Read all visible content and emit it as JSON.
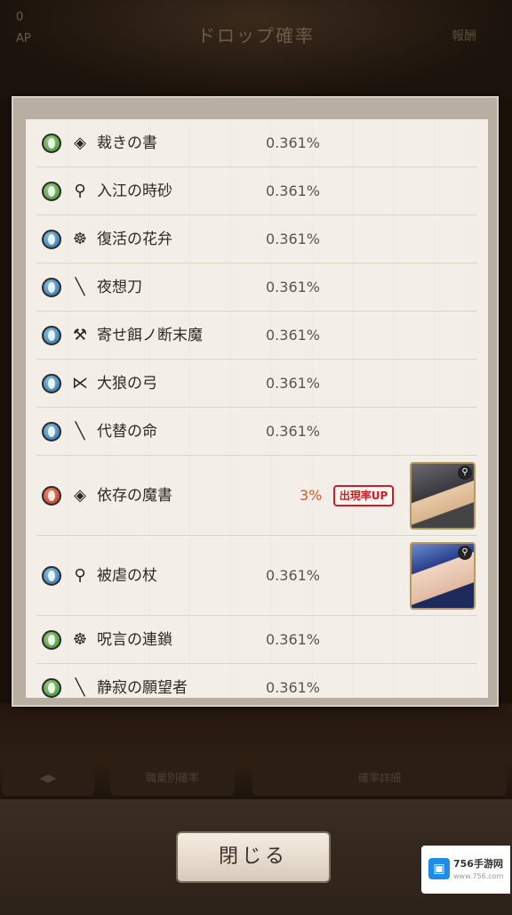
{
  "background": {
    "title": "ドロップ確率",
    "top_left_lines": [
      "0",
      "AP"
    ],
    "top_right": "報酬",
    "tabs": [
      "",
      "職業別確率",
      "確率詳細"
    ]
  },
  "items": [
    {
      "rarity": "green",
      "type_icon": "book-icon",
      "name": "裁きの書",
      "rate": "0.361%",
      "up": false
    },
    {
      "rarity": "green",
      "type_icon": "staff-icon",
      "name": "入江の時砂",
      "rate": "0.361%",
      "up": false
    },
    {
      "rarity": "blue",
      "type_icon": "orb-icon",
      "name": "復活の花弁",
      "rate": "0.361%",
      "up": false
    },
    {
      "rarity": "blue",
      "type_icon": "sword-icon",
      "name": "夜想刀",
      "rate": "0.361%",
      "up": false
    },
    {
      "rarity": "blue",
      "type_icon": "hammer-icon",
      "name": "寄せ餌ノ断末魔",
      "rate": "0.361%",
      "up": false
    },
    {
      "rarity": "blue",
      "type_icon": "bow-icon",
      "name": "大狼の弓",
      "rate": "0.361%",
      "up": false
    },
    {
      "rarity": "blue",
      "type_icon": "spear-icon",
      "name": "代替の命",
      "rate": "0.361%",
      "up": false
    },
    {
      "rarity": "red",
      "type_icon": "book-icon",
      "name": "依存の魔書",
      "rate": "3%",
      "up": true,
      "badge": "出現率UP"
    },
    {
      "rarity": "blue",
      "type_icon": "staff-icon",
      "name": "被虐の杖",
      "rate": "0.361%",
      "up": false
    },
    {
      "rarity": "green",
      "type_icon": "orb-icon",
      "name": "呪言の連鎖",
      "rate": "0.361%",
      "up": false
    },
    {
      "rarity": "green",
      "type_icon": "sword-icon",
      "name": "静寂の願望者",
      "rate": "0.361%",
      "up": false
    }
  ],
  "close_button": {
    "label": "閉じる"
  },
  "watermark": {
    "text": "756手游网",
    "sub": "www.756.com"
  },
  "colors": {
    "up_rate": "#d05a30",
    "up_badge": "#c8202a"
  }
}
